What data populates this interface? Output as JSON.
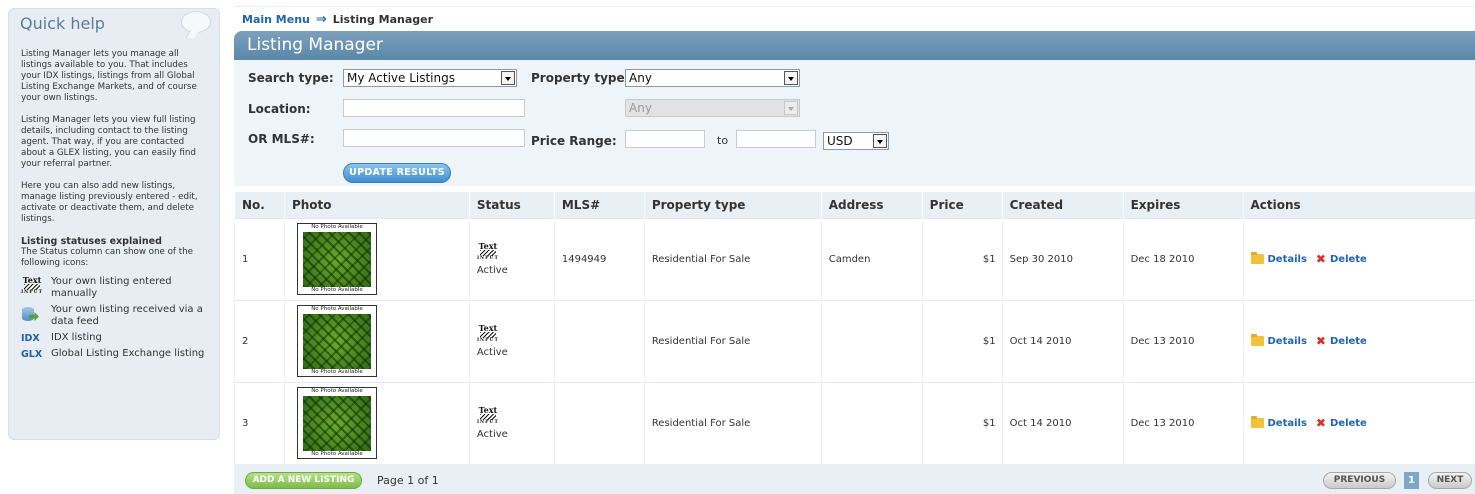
{
  "quick_help": {
    "title": "Quick help",
    "paragraphs": [
      "Listing Manager lets you manage all listings available to you. That includes your IDX listings, listings from all Global Listing Exchange Markets, and of course your own listings.",
      "Listing Manager lets you view full listing details, including contact to the listing agent. That way, if you are contacted about a GLEX listing, you can easily find your referral partner.",
      "Here you can also add new listings, manage listing previously entered - edit, activate or deactivate them, and delete listings."
    ],
    "statuses_title": "Listing statuses explained",
    "statuses_intro": "The Status column can show one of the following icons:",
    "legend": [
      {
        "icon": "text-input-icon",
        "text": "Your own listing entered manually"
      },
      {
        "icon": "data-feed-icon",
        "text": "Your own listing received via a data feed"
      },
      {
        "code": "IDX",
        "text": "IDX listing"
      },
      {
        "code": "GLX",
        "text": "Global Listing Exchange listing"
      }
    ],
    "text_icon": {
      "top": "Text",
      "bottom": "INPUT"
    }
  },
  "breadcrumb": {
    "home": "Main Menu",
    "current": "Listing Manager"
  },
  "panel_title": "Listing Manager",
  "search": {
    "search_type_label": "Search type:",
    "search_type_value": "My Active Listings",
    "property_type_label": "Property type:",
    "property_type_value": "Any",
    "location_label": "Location:",
    "location_value": "",
    "location_sub_value": "Any",
    "mls_label": "OR MLS#:",
    "mls_value": "",
    "price_range_label": "Price Range:",
    "price_from": "",
    "to_label": "to",
    "price_to": "",
    "currency": "USD",
    "update_button": "UPDATE RESULTS"
  },
  "table": {
    "columns": [
      "No.",
      "Photo",
      "Status",
      "MLS#",
      "Property type",
      "Address",
      "Price",
      "Created",
      "Expires",
      "Actions"
    ],
    "photo_caption": "No Photo Available",
    "rows": [
      {
        "no": "1",
        "status": "Active",
        "mls": "1494949",
        "property_type": "Residential For Sale",
        "address": "Camden",
        "price": "$1",
        "created": "Sep 30 2010",
        "expires": "Dec 18 2010"
      },
      {
        "no": "2",
        "status": "Active",
        "mls": "",
        "property_type": "Residential For Sale",
        "address": "",
        "price": "$1",
        "created": "Oct 14 2010",
        "expires": "Dec 13 2010"
      },
      {
        "no": "3",
        "status": "Active",
        "mls": "",
        "property_type": "Residential For Sale",
        "address": "",
        "price": "$1",
        "created": "Oct 14 2010",
        "expires": "Dec 13 2010"
      }
    ],
    "details_label": "Details",
    "delete_label": "Delete"
  },
  "footer": {
    "add_button": "ADD A NEW LISTING",
    "page_info": "Page 1 of 1",
    "previous": "PREVIOUS",
    "current_page": "1",
    "next": "NEXT"
  },
  "colors": {
    "header_blue": "#5a87a8",
    "link_blue": "#1f64b0",
    "add_green": "#7dbb47",
    "delete_red": "#d93025"
  }
}
